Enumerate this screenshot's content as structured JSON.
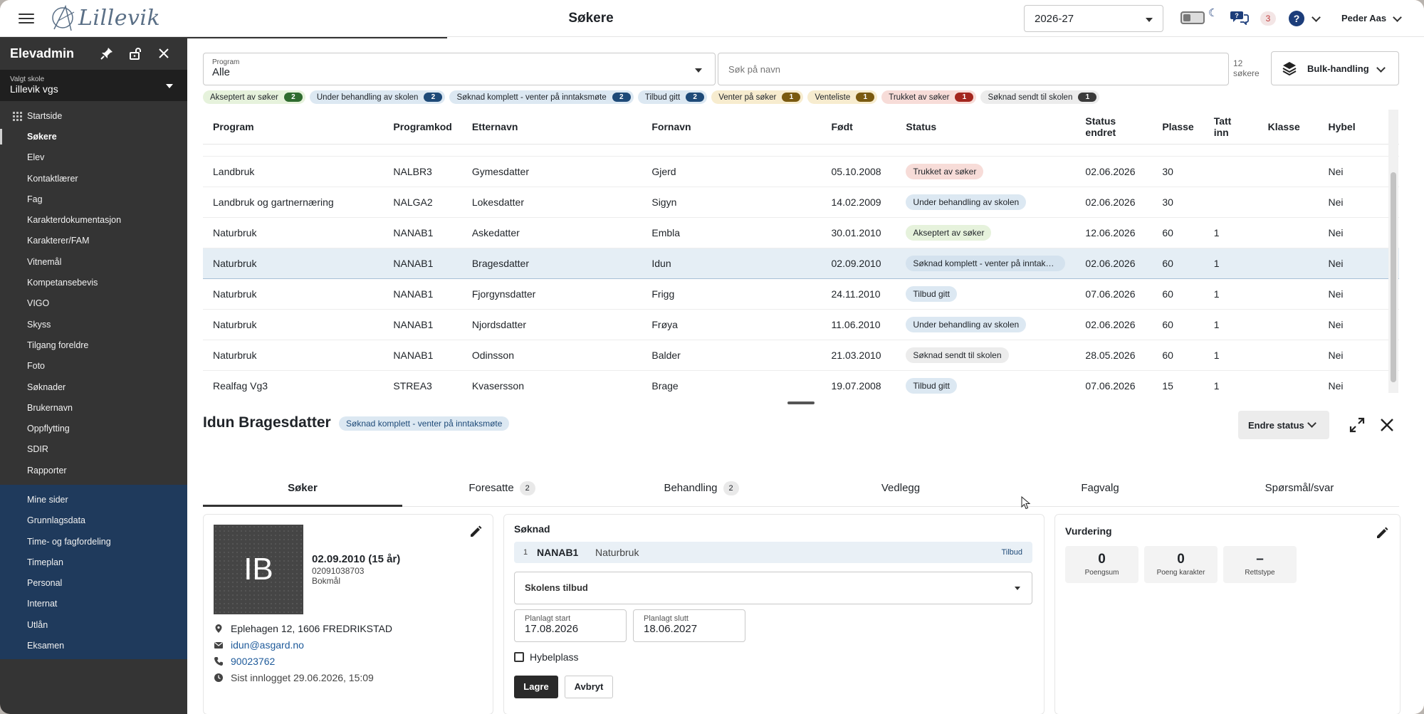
{
  "app": {
    "logo_text": "Lillevik",
    "page_title": "Søkere",
    "year": "2026-27",
    "notification_count": "3",
    "user": "Peder Aas"
  },
  "sidebar": {
    "title": "Elevadmin",
    "school_label": "Valgt skole",
    "school_value": "Lillevik vgs",
    "primary": [
      {
        "label": "Startside"
      },
      {
        "label": "Søkere"
      },
      {
        "label": "Elev"
      },
      {
        "label": "Kontaktlærer"
      },
      {
        "label": "Fag"
      },
      {
        "label": "Karakterdokumentasjon"
      },
      {
        "label": "Karakterer/FAM"
      },
      {
        "label": "Vitnemål"
      },
      {
        "label": "Kompetansebevis"
      },
      {
        "label": "VIGO"
      },
      {
        "label": "Skyss"
      },
      {
        "label": "Tilgang foreldre"
      },
      {
        "label": "Foto"
      },
      {
        "label": "Søknader"
      },
      {
        "label": "Brukernavn"
      },
      {
        "label": "Oppflytting"
      },
      {
        "label": "SDIR"
      },
      {
        "label": "Rapporter"
      }
    ],
    "secondary": [
      {
        "label": "Mine sider"
      },
      {
        "label": "Grunnlagsdata"
      },
      {
        "label": "Time- og fagfordeling"
      },
      {
        "label": "Timeplan"
      },
      {
        "label": "Personal"
      },
      {
        "label": "Internat"
      },
      {
        "label": "Utlån"
      },
      {
        "label": "Eksamen"
      }
    ]
  },
  "filters": {
    "program_label": "Program",
    "program_value": "Alle",
    "search_placeholder": "Søk på navn",
    "count_num": "12",
    "count_label": "søkere",
    "bulk_label": "Bulk-handling"
  },
  "chips": [
    {
      "label": "Akseptert av søker",
      "count": "2",
      "bg": "#e6f2dc",
      "num_bg": "#2f6b2f"
    },
    {
      "label": "Under behandling av skolen",
      "count": "2",
      "bg": "#dce8f2",
      "num_bg": "#1e4a78"
    },
    {
      "label": "Søknad komplett - venter på inntaksmøte",
      "count": "2",
      "bg": "#dce8f2",
      "num_bg": "#1e4a78"
    },
    {
      "label": "Tilbud gitt",
      "count": "2",
      "bg": "#dce8f2",
      "num_bg": "#1e4a78"
    },
    {
      "label": "Venter på søker",
      "count": "1",
      "bg": "#f7eccf",
      "num_bg": "#7a5a10"
    },
    {
      "label": "Venteliste",
      "count": "1",
      "bg": "#f7eccf",
      "num_bg": "#7a5a10"
    },
    {
      "label": "Trukket av søker",
      "count": "1",
      "bg": "#f7dcd8",
      "num_bg": "#a3261e"
    },
    {
      "label": "Søknad sendt til skolen",
      "count": "1",
      "bg": "#ececec",
      "num_bg": "#3a3a3a"
    }
  ],
  "table": {
    "headers": [
      "Program",
      "Programkod",
      "Etternavn",
      "Fornavn",
      "Født",
      "Status",
      "Status endret",
      "Plasse",
      "Tatt inn",
      "Klasse",
      "Hybel"
    ],
    "rows": [
      {
        "program": "Landbruk",
        "code": "NALBR3",
        "last": "Gymesdatter",
        "first": "Gjerd",
        "born": "05.10.2008",
        "status": "Trukket av søker",
        "status_bg": "#f7dcd8",
        "changed": "02.06.2026",
        "places": "30",
        "admitted": "",
        "klasse": "",
        "hybel": "Nei"
      },
      {
        "program": "Landbruk og gartnernæring",
        "code": "NALGA2",
        "last": "Lokesdatter",
        "first": "Sigyn",
        "born": "14.02.2009",
        "status": "Under behandling av skolen",
        "status_bg": "#dce8f2",
        "changed": "02.06.2026",
        "places": "30",
        "admitted": "",
        "klasse": "",
        "hybel": "Nei"
      },
      {
        "program": "Naturbruk",
        "code": "NANAB1",
        "last": "Askedatter",
        "first": "Embla",
        "born": "30.01.2010",
        "status": "Akseptert av søker",
        "status_bg": "#e6f2dc",
        "changed": "12.06.2026",
        "places": "60",
        "admitted": "1",
        "klasse": "",
        "hybel": "Nei"
      },
      {
        "program": "Naturbruk",
        "code": "NANAB1",
        "last": "Bragesdatter",
        "first": "Idun",
        "born": "02.09.2010",
        "status": "Søknad komplett - venter på inntaksmøte",
        "status_bg": "#d4e2ee",
        "changed": "02.06.2026",
        "places": "60",
        "admitted": "1",
        "klasse": "",
        "hybel": "Nei"
      },
      {
        "program": "Naturbruk",
        "code": "NANAB1",
        "last": "Fjorgynsdatter",
        "first": "Frigg",
        "born": "24.11.2010",
        "status": "Tilbud gitt",
        "status_bg": "#dce8f2",
        "changed": "07.06.2026",
        "places": "60",
        "admitted": "1",
        "klasse": "",
        "hybel": "Nei"
      },
      {
        "program": "Naturbruk",
        "code": "NANAB1",
        "last": "Njordsdatter",
        "first": "Frøya",
        "born": "11.06.2010",
        "status": "Under behandling av skolen",
        "status_bg": "#dce8f2",
        "changed": "02.06.2026",
        "places": "60",
        "admitted": "1",
        "klasse": "",
        "hybel": "Nei"
      },
      {
        "program": "Naturbruk",
        "code": "NANAB1",
        "last": "Odinsson",
        "first": "Balder",
        "born": "21.03.2010",
        "status": "Søknad sendt til skolen",
        "status_bg": "#ececec",
        "changed": "28.05.2026",
        "places": "60",
        "admitted": "1",
        "klasse": "",
        "hybel": "Nei"
      },
      {
        "program": "Realfag Vg3",
        "code": "STREA3",
        "last": "Kvasersson",
        "first": "Brage",
        "born": "19.07.2008",
        "status": "Tilbud gitt",
        "status_bg": "#dce8f2",
        "changed": "07.06.2026",
        "places": "15",
        "admitted": "1",
        "klasse": "",
        "hybel": "Nei"
      }
    ]
  },
  "detail": {
    "name": "Idun Bragesdatter",
    "status": "Søknad komplett - venter på inntaksmøte",
    "change_status_label": "Endre status",
    "tabs": [
      {
        "label": "Søker",
        "count": ""
      },
      {
        "label": "Foresatte",
        "count": "2"
      },
      {
        "label": "Behandling",
        "count": "2"
      },
      {
        "label": "Vedlegg",
        "count": ""
      },
      {
        "label": "Fagvalg",
        "count": ""
      },
      {
        "label": "Spørsmål/svar",
        "count": ""
      }
    ],
    "person": {
      "initials": "IB",
      "birth": "02.09.2010 (15 år)",
      "pnr": "02091038703",
      "language": "Bokmål",
      "address": "Eplehagen 12, 1606 FREDRIKSTAD",
      "email": "idun@asgard.no",
      "phone": "90023762",
      "last_login": "Sist innlogget 29.06.2026, 15:09"
    },
    "application": {
      "title": "Søknad",
      "row_num": "1",
      "row_code": "NANAB1",
      "row_program": "Naturbruk",
      "row_tag": "Tilbud",
      "offer_placeholder": "Skolens tilbud",
      "start_label": "Planlagt start",
      "start_value": "17.08.2026",
      "end_label": "Planlagt slutt",
      "end_value": "18.06.2027",
      "hybel_label": "Hybelplass",
      "save_label": "Lagre",
      "cancel_label": "Avbryt"
    },
    "evaluation": {
      "title": "Vurdering",
      "scores": [
        {
          "value": "0",
          "label": "Poengsum"
        },
        {
          "value": "0",
          "label": "Poeng karakter"
        },
        {
          "value": "–",
          "label": "Rettstype"
        }
      ]
    }
  }
}
